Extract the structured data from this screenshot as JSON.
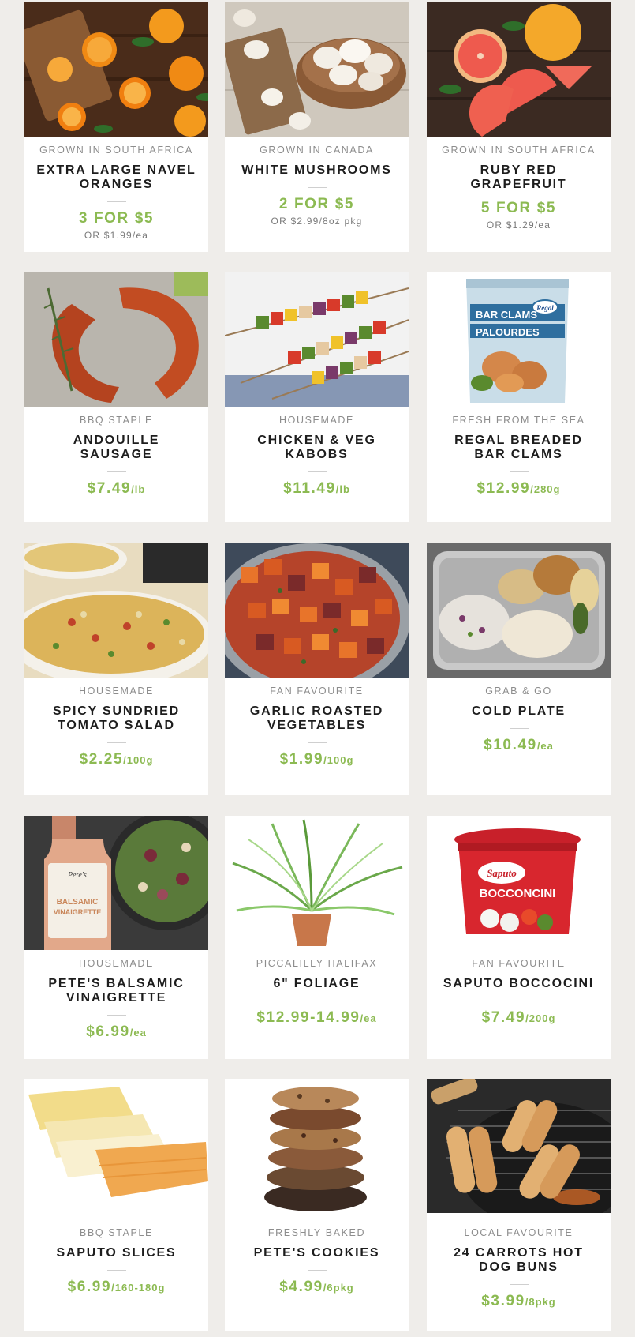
{
  "products": [
    {
      "origin": "GROWN IN SOUTH AFRICA",
      "title": "EXTRA LARGE NAVEL ORANGES",
      "price": "3 FOR $5",
      "unit": "",
      "sub": "OR $1.99/ea",
      "image": "oranges-photo"
    },
    {
      "origin": "GROWN IN CANADA",
      "title": "WHITE MUSHROOMS",
      "price": "2 FOR $5",
      "unit": "",
      "sub": "OR $2.99/8oz pkg",
      "image": "mushrooms-photo"
    },
    {
      "origin": "GROWN IN SOUTH AFRICA",
      "title": "RUBY RED GRAPEFRUIT",
      "price": "5 FOR $5",
      "unit": "",
      "sub": "OR $1.29/ea",
      "image": "grapefruit-photo"
    },
    {
      "origin": "BBQ STAPLE",
      "title": "ANDOUILLE SAUSAGE",
      "price": "$7.49",
      "unit": "/lb",
      "sub": "",
      "image": "sausage-photo"
    },
    {
      "origin": "HOUSEMADE",
      "title": "CHICKEN & VEG KABOBS",
      "price": "$11.49",
      "unit": "/lb",
      "sub": "",
      "image": "kabobs-photo"
    },
    {
      "origin": "FRESH FROM THE SEA",
      "title": "REGAL BREADED BAR CLAMS",
      "price": "$12.99",
      "unit": "/280g",
      "sub": "",
      "image": "clams-photo"
    },
    {
      "origin": "HOUSEMADE",
      "title": "SPICY SUNDRIED TOMATO SALAD",
      "price": "$2.25",
      "unit": "/100g",
      "sub": "",
      "image": "pasta-salad-photo"
    },
    {
      "origin": "FAN FAVOURITE",
      "title": "GARLIC ROASTED VEGETABLES",
      "price": "$1.99",
      "unit": "/100g",
      "sub": "",
      "image": "roasted-vegetables-photo"
    },
    {
      "origin": "GRAB & GO",
      "title": "COLD PLATE",
      "price": "$10.49",
      "unit": "/ea",
      "sub": "",
      "image": "cold-plate-photo"
    },
    {
      "origin": "HOUSEMADE",
      "title": "PETE'S BALSAMIC VINAIGRETTE",
      "price": "$6.99",
      "unit": "/ea",
      "sub": "",
      "image": "vinaigrette-photo"
    },
    {
      "origin": "PICCALILLY HALIFAX",
      "title": "6\" FOLIAGE",
      "price": "$12.99-14.99",
      "unit": "/ea",
      "sub": "",
      "image": "foliage-photo"
    },
    {
      "origin": "FAN FAVOURITE",
      "title": "SAPUTO BOCCOCINI",
      "price": "$7.49",
      "unit": "/200g",
      "sub": "",
      "image": "bocconcini-photo"
    },
    {
      "origin": "BBQ STAPLE",
      "title": "SAPUTO SLICES",
      "price": "$6.99",
      "unit": "/160-180g",
      "sub": "",
      "image": "cheese-slices-photo"
    },
    {
      "origin": "FRESHLY BAKED",
      "title": "PETE'S COOKIES",
      "price": "$4.99",
      "unit": "/6pkg",
      "sub": "",
      "image": "cookies-photo"
    },
    {
      "origin": "LOCAL FAVOURITE",
      "title": "24 CARROTS HOT DOG BUNS",
      "price": "$3.99",
      "unit": "/8pkg",
      "sub": "",
      "image": "hot-dog-buns-photo"
    }
  ],
  "image_text": {
    "clams_brand": "Regal",
    "clams_line1": "BAR CLAMS",
    "clams_line2": "PALOURDES",
    "vinaigrette_brand": "Pete's",
    "vinaigrette_line1": "BALSAMIC",
    "vinaigrette_line2": "VINAIGRETTE",
    "bocconcini_brand": "Saputo",
    "bocconcini_name": "BOCCONCINI"
  },
  "colors": {
    "price_green": "#8cba52",
    "page_bg": "#efedea",
    "title": "#1d1d1d",
    "origin": "#8d8d8d"
  }
}
